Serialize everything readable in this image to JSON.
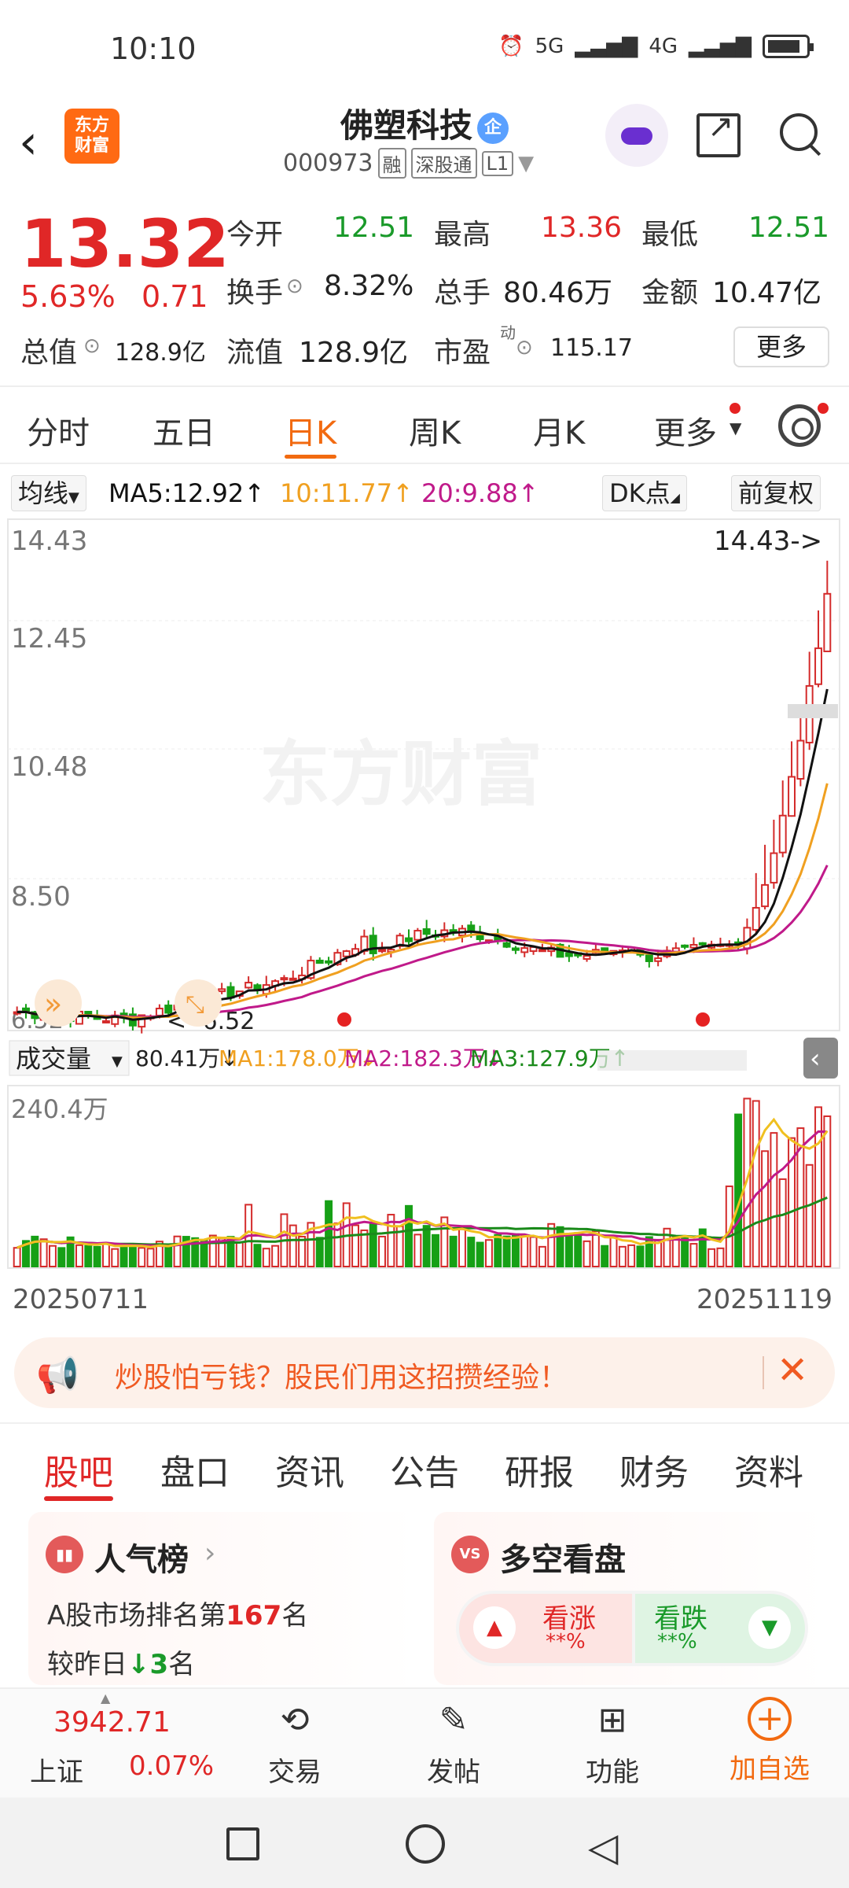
{
  "status_bar": {
    "time": "10:10",
    "signal1": "5G",
    "signal2": "4G"
  },
  "header": {
    "back_icon": "chevron-left-icon",
    "logo_text": "东方\n财富",
    "stock_name": "佛塑科技",
    "badge": "企",
    "stock_code": "000973",
    "tags": [
      "融",
      "深股通",
      "L1"
    ]
  },
  "quote": {
    "price": "13.32",
    "change_pct": "5.63%",
    "change": "0.71",
    "open_label": "今开",
    "open": "12.51",
    "high_label": "最高",
    "high": "13.36",
    "low_label": "最低",
    "low": "12.51",
    "turnover_label": "换手",
    "turnover": "8.32%",
    "volume_label": "总手",
    "volume": "80.46万",
    "amount_label": "金额",
    "amount": "10.47亿",
    "mktcap_label": "总值",
    "mktcap": "128.9亿",
    "float_label": "流值",
    "float": "128.9亿",
    "pe_label": "市盈",
    "pe_sup": "动",
    "pe": "115.17",
    "more": "更多"
  },
  "period_tabs": [
    "分时",
    "五日",
    "日K",
    "周K",
    "月K",
    "更多"
  ],
  "ma_legend": {
    "selector": "均线",
    "ma5": "MA5:12.92↑",
    "ma10": "10:11.77↑",
    "ma20": "20:9.88↑",
    "dk": "DK点",
    "adjust": "前复权"
  },
  "chart_data": {
    "type": "candlestick",
    "y_ticks": [
      "14.43",
      "12.45",
      "10.48",
      "8.50",
      "6.52"
    ],
    "ylim": [
      6.52,
      14.43
    ],
    "high_marker": "14.43->",
    "low_marker": "<- 6.52",
    "watermark": "东方财富",
    "start_date": "20250711",
    "end_date": "20251119",
    "volume": {
      "selector": "成交量",
      "current": "80.41万↓",
      "ma1": "MA1:178.0万↓",
      "ma2": "MA2:182.3万↓",
      "ma3": "MA3:127.9万↑",
      "max_label": "240.4万"
    },
    "colors": {
      "up": "#d42b2b",
      "down": "#16a016",
      "ma5": "#111111",
      "ma10": "#f0a020",
      "ma20": "#c01a8a",
      "vol_ma3": "#1a8a1a"
    }
  },
  "ad": {
    "text": "炒股怕亏钱？股民们用这招攒经验！"
  },
  "content_tabs": [
    "股吧",
    "盘口",
    "资讯",
    "公告",
    "研报",
    "财务",
    "资料"
  ],
  "cards": {
    "popularity": {
      "title": "人气榜",
      "line1_a": "A股市场排名第",
      "rank": "167",
      "line1_b": "名",
      "line2_a": "较昨日",
      "delta": "3",
      "line2_b": "名"
    },
    "sentiment": {
      "title": "多空看盘",
      "bull": "看涨",
      "bull_pct": "**%",
      "bear": "看跌",
      "bear_pct": "**%"
    }
  },
  "bottom_nav": {
    "index_value": "3942.71",
    "index_name": "上证",
    "index_change": "0.07%",
    "items": [
      "交易",
      "发帖",
      "功能",
      "加自选"
    ]
  }
}
